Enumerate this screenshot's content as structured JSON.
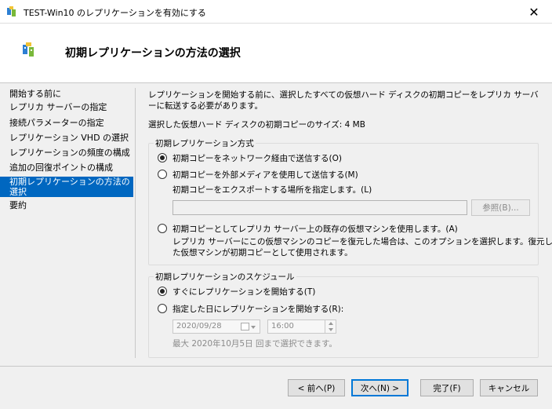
{
  "window": {
    "title": "TEST-Win10 のレプリケーションを有効にする",
    "close_glyph": "✕"
  },
  "header": {
    "title": "初期レプリケーションの方法の選択"
  },
  "sidebar": {
    "items": [
      {
        "label": "開始する前に"
      },
      {
        "label": "レプリカ サーバーの指定"
      },
      {
        "label": "接続パラメーターの指定"
      },
      {
        "label": "レプリケーション VHD の選択"
      },
      {
        "label": "レプリケーションの頻度の構成"
      },
      {
        "label": "追加の回復ポイントの構成"
      },
      {
        "label": "初期レプリケーションの方法の選択",
        "active": true
      },
      {
        "label": "要約"
      }
    ]
  },
  "main": {
    "intro": "レプリケーションを開始する前に、選択したすべての仮想ハード ディスクの初期コピーをレプリカ サーバーに転送する必要があります。",
    "size_label": "選択した仮想ハード ディスクの初期コピーのサイズ: 4 MB",
    "method_group": {
      "label": "初期レプリケーション方式",
      "options": [
        {
          "label": "初期コピーをネットワーク経由で送信する(O)",
          "checked": true
        },
        {
          "label": "初期コピーを外部メディアを使用して送信する(M)",
          "checked": false
        },
        {
          "label": "初期コピーとしてレプリカ サーバー上の既存の仮想マシンを使用します。(A)",
          "checked": false
        }
      ],
      "export_location_label": "初期コピーをエクスポートする場所を指定します。(L)",
      "export_path_value": "",
      "browse_label": "参照(B)...",
      "existing_vm_note_line1": "レプリカ サーバーにこの仮想マシンのコピーを復元した場合は、このオプションを選択します。復元し",
      "existing_vm_note_line2": "た仮想マシンが初期コピーとして使用されます。"
    },
    "schedule_group": {
      "label": "初期レプリケーションのスケジュール",
      "options": [
        {
          "label": "すぐにレプリケーションを開始する(T)",
          "checked": true
        },
        {
          "label": "指定した日にレプリケーションを開始する(R):",
          "checked": false
        }
      ],
      "date_value": "2020/09/28",
      "time_value": "16:00",
      "max_note": "最大 2020年10月5日 回まで選択できます。"
    }
  },
  "footer": {
    "prev_label": "< 前へ(P)",
    "next_label": "次へ(N) >",
    "finish_label": "完了(F)",
    "cancel_label": "キャンセル"
  },
  "colors": {
    "accent": "#0067c0",
    "default_button_border": "#0078d7"
  }
}
